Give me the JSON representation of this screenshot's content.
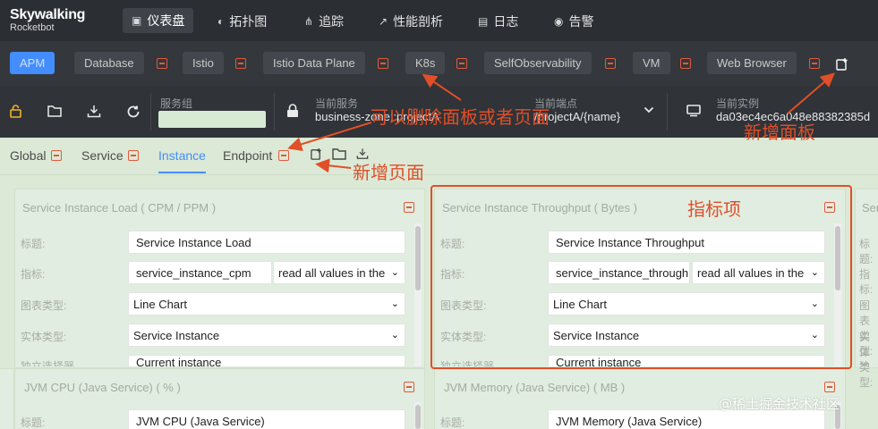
{
  "brand": {
    "name": "Skywalking",
    "sub": "Rocketbot"
  },
  "nav": [
    {
      "icon": "dashboard-icon",
      "glyph": "▣",
      "label": "仪表盘",
      "active": true
    },
    {
      "icon": "topology-icon",
      "glyph": "◐",
      "label": "拓扑图"
    },
    {
      "icon": "trace-icon",
      "glyph": "⋔",
      "label": "追踪"
    },
    {
      "icon": "profile-icon",
      "glyph": "↗",
      "label": "性能剖析"
    },
    {
      "icon": "log-icon",
      "glyph": "▤",
      "label": "日志"
    },
    {
      "icon": "alarm-icon",
      "glyph": "◉",
      "label": "告警"
    }
  ],
  "templates": [
    "APM",
    "Database",
    "Istio",
    "Istio Data Plane",
    "K8s",
    "SelfObservability",
    "VM",
    "Web Browser"
  ],
  "toolbar": {
    "service_group_label": "服务组",
    "service_label": "当前服务",
    "service_value": "business-zone::projectA",
    "endpoint_label": "当前端点",
    "endpoint_value": "/projectA/{name}",
    "instance_label": "当前实例",
    "instance_value": "da03ec4ec6a048e88382385d"
  },
  "page_tabs": [
    "Global",
    "Service",
    "Instance",
    "Endpoint"
  ],
  "active_page_tab": "Instance",
  "cards": [
    {
      "title": "Service Instance Load ( CPM / PPM )",
      "title_label": "标题:",
      "title_value": "Service Instance Load",
      "metric_label": "指标:",
      "metric_value": "service_instance_cpm",
      "metric_mode": "read all values in the",
      "chart_label": "图表类型:",
      "chart_value": "Line Chart",
      "entity_label": "实体类型:",
      "entity_value": "Service Instance",
      "extra_label": "独立选择器",
      "extra_value": "Current instance"
    },
    {
      "title": "Service Instance Throughput ( Bytes )",
      "title_label": "标题:",
      "title_value": "Service Instance Throughput",
      "metric_label": "指标:",
      "metric_value": "service_instance_throughput",
      "metric_mode": "read all values in the",
      "chart_label": "图表类型:",
      "chart_value": "Line Chart",
      "entity_label": "实体类型:",
      "entity_value": "Service Instance",
      "extra_label": "独立选择器",
      "extra_value": "Current instance"
    },
    {
      "title": "JVM CPU (Java Service) ( % )",
      "title_label": "标题:",
      "title_value": "JVM CPU (Java Service)"
    },
    {
      "title": "JVM Memory (Java Service) ( MB )",
      "title_label": "标题:",
      "title_value": "JVM Memory (Java Service)"
    }
  ],
  "side_labels": {
    "title": "标题:",
    "metric": "指标:",
    "chart": "图表类型:",
    "entity": "实体类型:",
    "extra": "独立选择器"
  },
  "annotations": {
    "delete_panel": "可以删除面板或者页面",
    "add_panel": "新增面板",
    "add_page": "新增页面",
    "metric_item": "指标项"
  },
  "watermark": "@稀土掘金技术社区"
}
